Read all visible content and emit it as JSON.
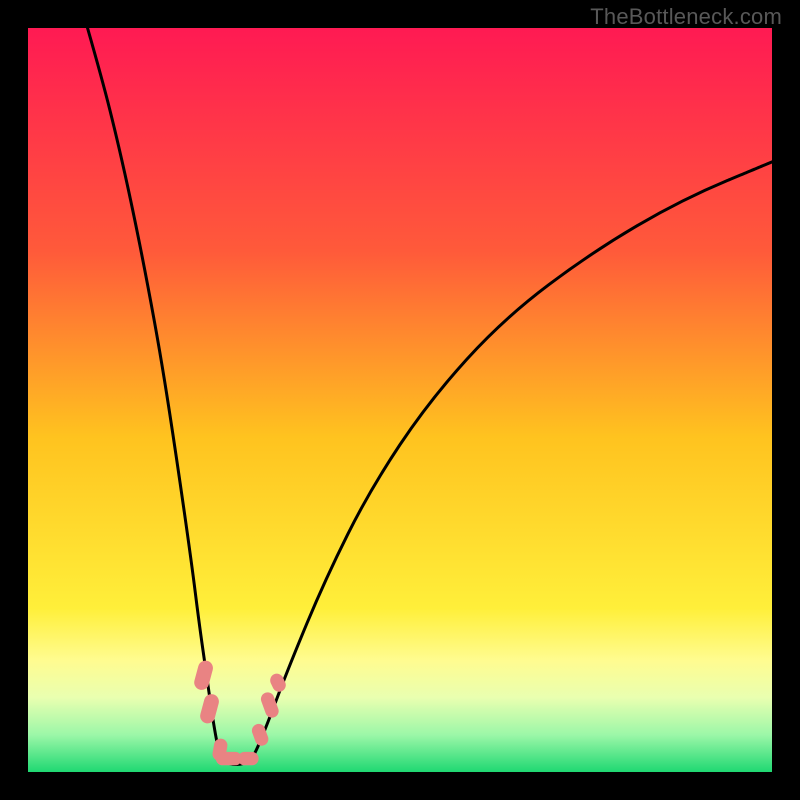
{
  "watermark": "TheBottleneck.com",
  "chart_data": {
    "type": "line",
    "title": "",
    "xlabel": "",
    "ylabel": "",
    "xlim": [
      0,
      100
    ],
    "ylim": [
      0,
      100
    ],
    "grid": false,
    "background_gradient": {
      "stops": [
        {
          "offset": 0.0,
          "color": "#ff1a53"
        },
        {
          "offset": 0.3,
          "color": "#ff5a3a"
        },
        {
          "offset": 0.55,
          "color": "#ffc31f"
        },
        {
          "offset": 0.78,
          "color": "#ffef3a"
        },
        {
          "offset": 0.85,
          "color": "#fffc90"
        },
        {
          "offset": 0.9,
          "color": "#e9ffb0"
        },
        {
          "offset": 0.95,
          "color": "#9cf7a8"
        },
        {
          "offset": 1.0,
          "color": "#1fd872"
        }
      ]
    },
    "series": [
      {
        "name": "curve-left",
        "x": [
          8,
          10,
          12,
          14,
          16,
          18,
          20,
          22,
          23,
          24,
          25,
          25.8
        ],
        "y": [
          100,
          93,
          85,
          76,
          66,
          55,
          42,
          28,
          20,
          13,
          6,
          2
        ]
      },
      {
        "name": "curve-bottom",
        "x": [
          25.8,
          26.5,
          27.5,
          28.5,
          29.5,
          30.3
        ],
        "y": [
          2,
          1.3,
          1.0,
          1.0,
          1.3,
          2
        ]
      },
      {
        "name": "curve-right",
        "x": [
          30.3,
          32,
          35,
          40,
          46,
          54,
          64,
          76,
          88,
          100
        ],
        "y": [
          2,
          6,
          14,
          26,
          38,
          50,
          61,
          70,
          77,
          82
        ]
      }
    ],
    "markers": [
      {
        "shape": "pill",
        "x": 23.6,
        "y": 13.0,
        "w": 2.0,
        "h": 4.0,
        "rot": 15
      },
      {
        "shape": "pill",
        "x": 24.4,
        "y": 8.5,
        "w": 2.0,
        "h": 4.0,
        "rot": 15
      },
      {
        "shape": "pill",
        "x": 25.8,
        "y": 3.0,
        "w": 1.8,
        "h": 3.0,
        "rot": 10
      },
      {
        "shape": "pill",
        "x": 27.0,
        "y": 1.8,
        "w": 3.5,
        "h": 1.8,
        "rot": 0
      },
      {
        "shape": "pill",
        "x": 29.6,
        "y": 1.8,
        "w": 2.8,
        "h": 1.8,
        "rot": 0
      },
      {
        "shape": "pill",
        "x": 31.2,
        "y": 5.0,
        "w": 1.8,
        "h": 3.0,
        "rot": -20
      },
      {
        "shape": "pill",
        "x": 32.5,
        "y": 9.0,
        "w": 1.8,
        "h": 3.5,
        "rot": -20
      },
      {
        "shape": "pill",
        "x": 33.6,
        "y": 12.0,
        "w": 1.8,
        "h": 2.5,
        "rot": -25
      }
    ],
    "colors": {
      "curve": "#000000",
      "marker": "#e98383",
      "frame": "#000000"
    }
  }
}
